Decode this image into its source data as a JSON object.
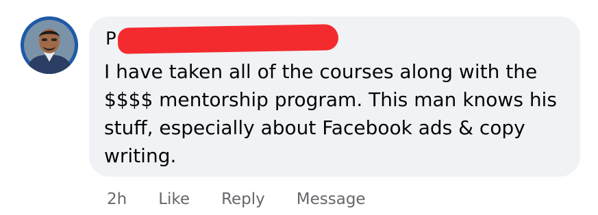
{
  "comment": {
    "author_visible_prefix": "P",
    "text": "I have taken all of the courses along with the $$$$ mentorship program. This man knows his stuff, especially about Facebook ads & copy writing.",
    "timestamp": "2h",
    "actions": {
      "like": "Like",
      "reply": "Reply",
      "message": "Message"
    }
  },
  "colors": {
    "bubble": "#f0f2f5",
    "redaction": "#f42b2e",
    "action_text": "#65676b",
    "avatar_ring": "#1f5aa6"
  }
}
